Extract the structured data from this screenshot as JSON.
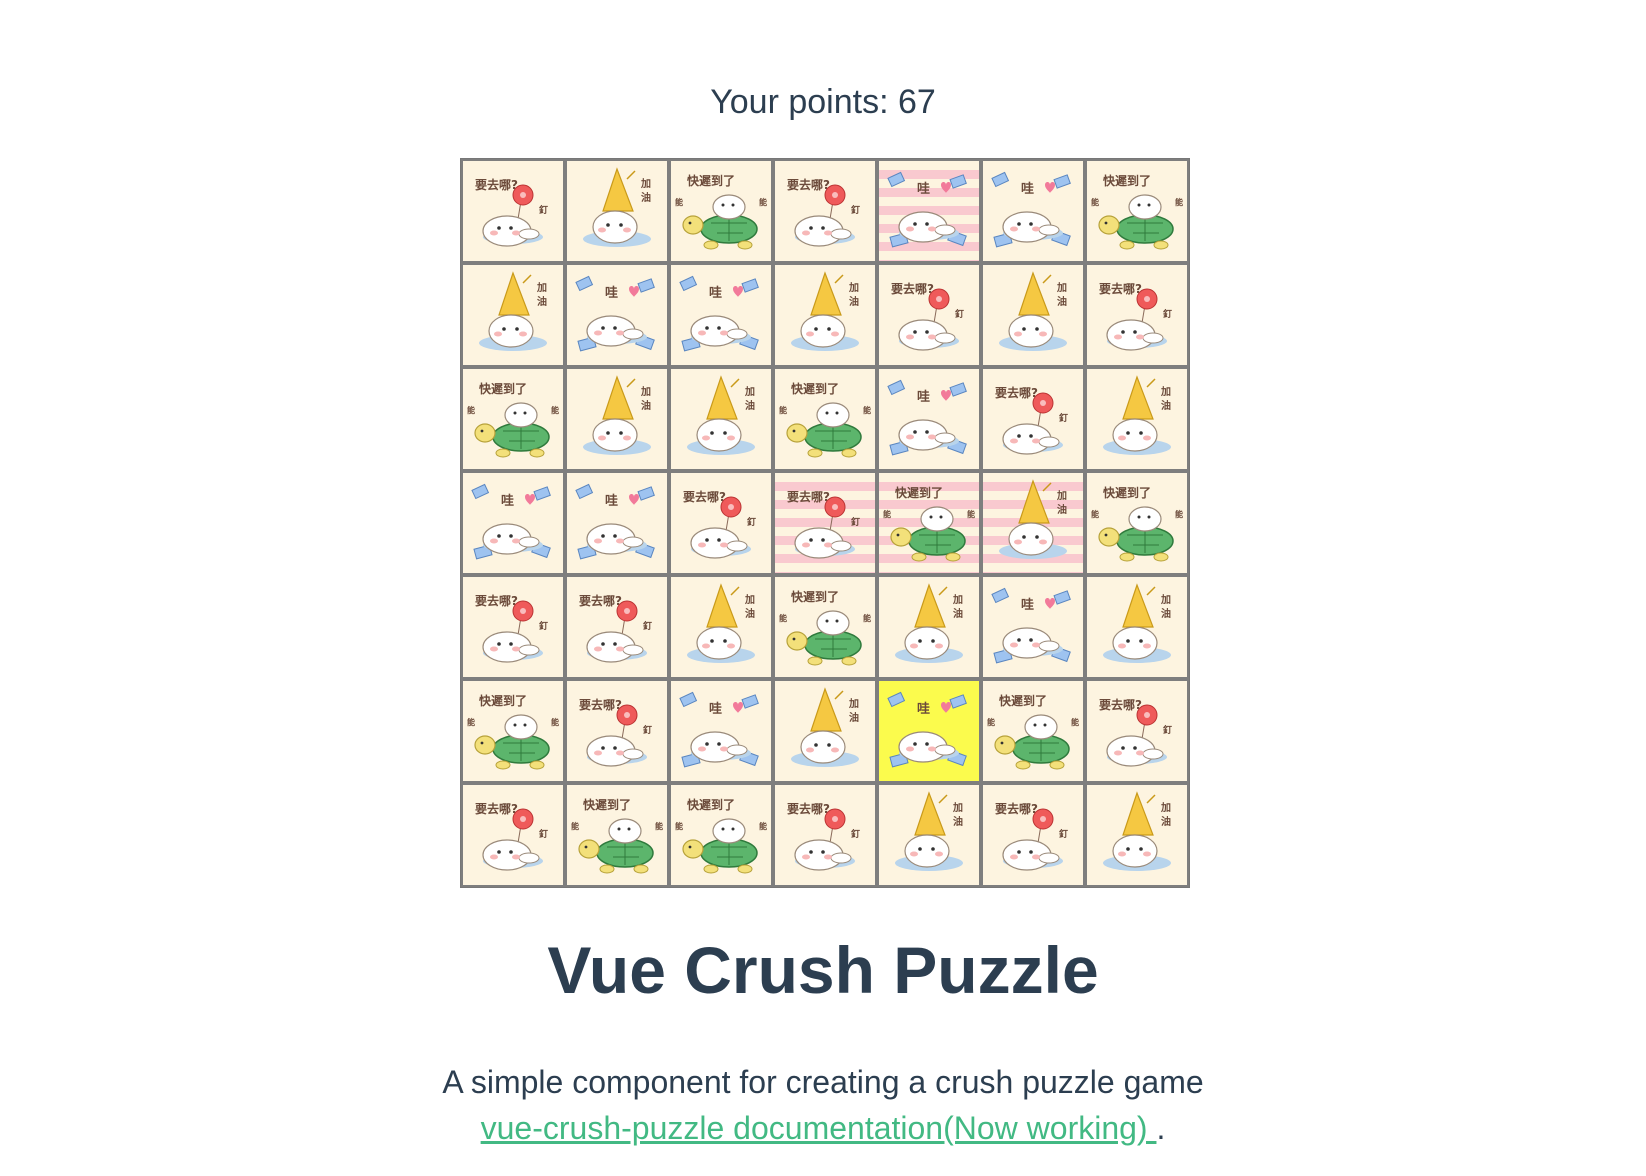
{
  "score": {
    "label": "Your points: 67"
  },
  "board": {
    "rows": [
      [
        {
          "tile": "where"
        },
        {
          "tile": "cheer"
        },
        {
          "tile": "late"
        },
        {
          "tile": "where"
        },
        {
          "tile": "wow",
          "state": "striped"
        },
        {
          "tile": "wow"
        },
        {
          "tile": "late"
        }
      ],
      [
        {
          "tile": "cheer"
        },
        {
          "tile": "wow"
        },
        {
          "tile": "wow"
        },
        {
          "tile": "cheer"
        },
        {
          "tile": "where"
        },
        {
          "tile": "cheer"
        },
        {
          "tile": "where"
        }
      ],
      [
        {
          "tile": "late"
        },
        {
          "tile": "cheer"
        },
        {
          "tile": "cheer"
        },
        {
          "tile": "late"
        },
        {
          "tile": "wow"
        },
        {
          "tile": "where"
        },
        {
          "tile": "cheer"
        }
      ],
      [
        {
          "tile": "wow"
        },
        {
          "tile": "wow"
        },
        {
          "tile": "where"
        },
        {
          "tile": "where",
          "state": "striped"
        },
        {
          "tile": "late",
          "state": "striped"
        },
        {
          "tile": "cheer",
          "state": "striped"
        },
        {
          "tile": "late"
        }
      ],
      [
        {
          "tile": "where"
        },
        {
          "tile": "where"
        },
        {
          "tile": "cheer"
        },
        {
          "tile": "late"
        },
        {
          "tile": "cheer"
        },
        {
          "tile": "wow"
        },
        {
          "tile": "cheer"
        }
      ],
      [
        {
          "tile": "late"
        },
        {
          "tile": "where"
        },
        {
          "tile": "wow"
        },
        {
          "tile": "cheer"
        },
        {
          "tile": "wow",
          "state": "selected"
        },
        {
          "tile": "late"
        },
        {
          "tile": "where"
        }
      ],
      [
        {
          "tile": "where"
        },
        {
          "tile": "late"
        },
        {
          "tile": "late"
        },
        {
          "tile": "where"
        },
        {
          "tile": "cheer"
        },
        {
          "tile": "where"
        },
        {
          "tile": "cheer"
        }
      ]
    ],
    "tile_captions": {
      "where": "要去哪?",
      "cheer": "加油",
      "late": "快遲到了",
      "wow": "哇"
    },
    "tile_icons": {
      "where": "seal-with-red-balloon-icon",
      "cheer": "seal-with-yellow-hat-icon",
      "late": "seal-riding-turtle-icon",
      "wow": "seal-with-money-icon"
    },
    "colors": {
      "tile_bg": "#fdf4e0",
      "striped": "#f9c9cf",
      "selected": "#fbfb4d",
      "border": "#7e7e7e"
    }
  },
  "title": "Vue Crush Puzzle",
  "description": "A simple component for creating a crush puzzle game",
  "docs_link": {
    "text": "vue-crush-puzzle documentation(Now working) ",
    "trailing": "."
  },
  "colors": {
    "text": "#2c3e50",
    "link": "#42b983"
  }
}
